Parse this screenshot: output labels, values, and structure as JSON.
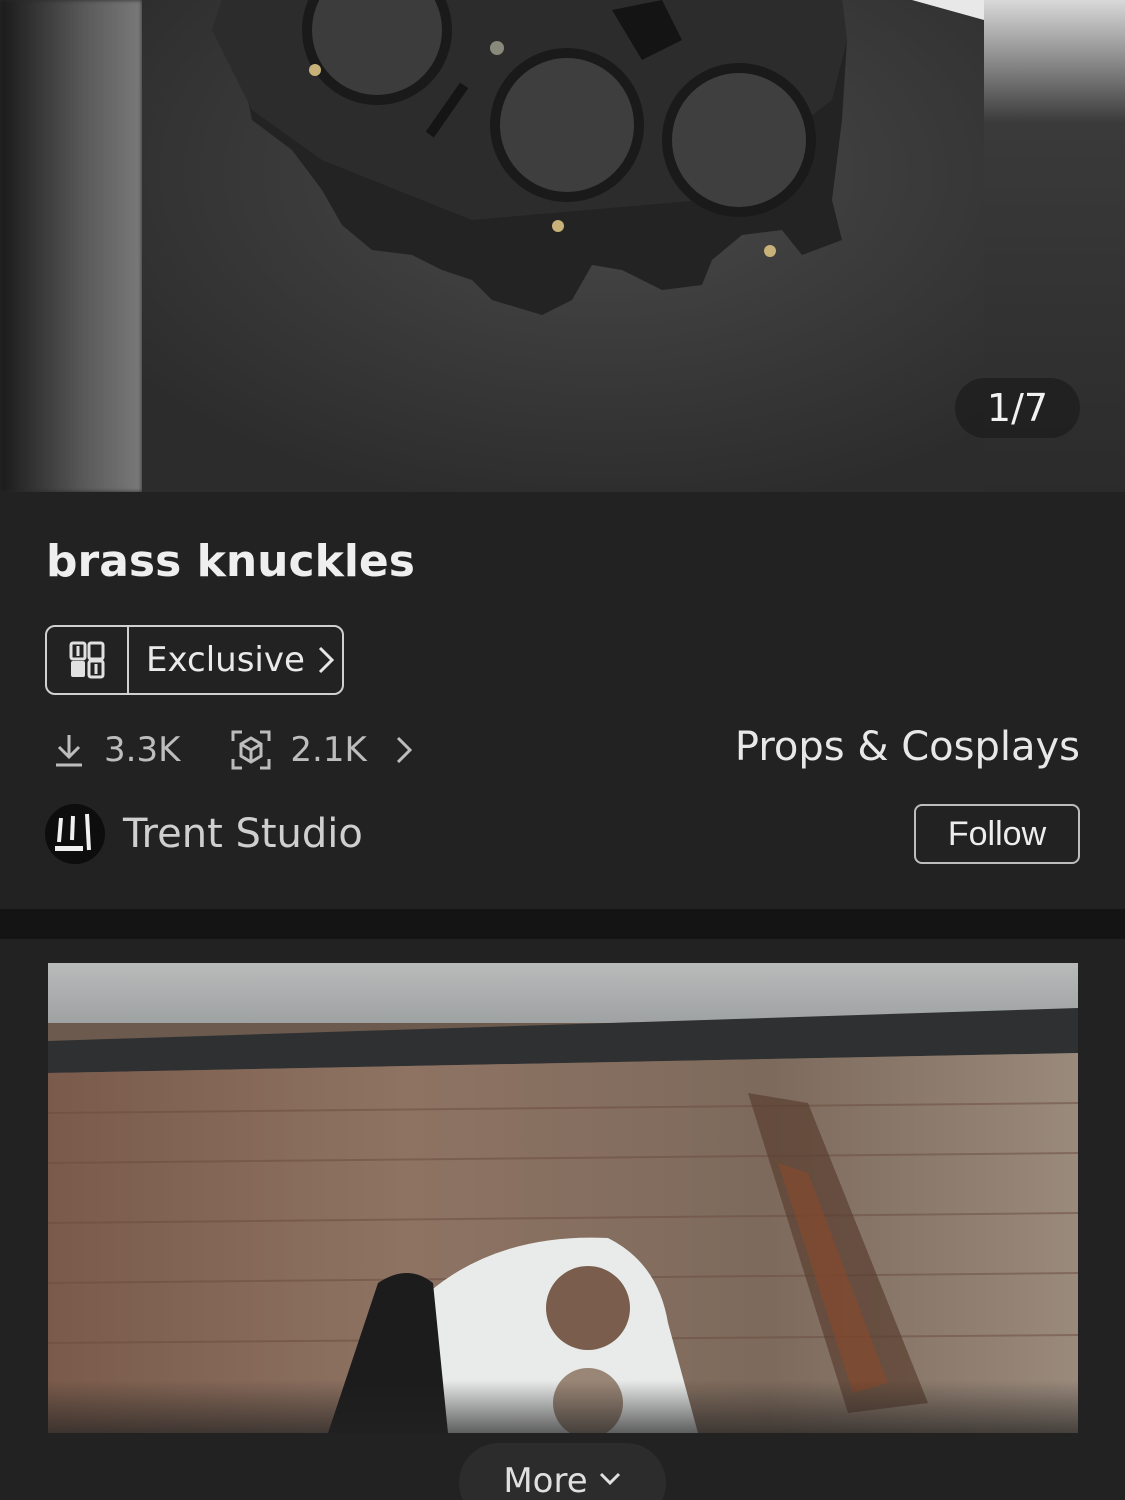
{
  "gallery": {
    "counter": "1/7"
  },
  "model": {
    "title": "brass knuckles",
    "badge": {
      "label": "Exclusive",
      "icon": "cube-grid-icon"
    },
    "downloads": "3.3K",
    "prints": "2.1K",
    "category": "Props & Cosplays"
  },
  "author": {
    "name": "Trent Studio",
    "follow_label": "Follow"
  },
  "footer": {
    "more_label": "More"
  },
  "colors": {
    "background": "#222222",
    "divider": "#141414",
    "text": "#e6e6e6",
    "muted": "#bdbdbd"
  }
}
